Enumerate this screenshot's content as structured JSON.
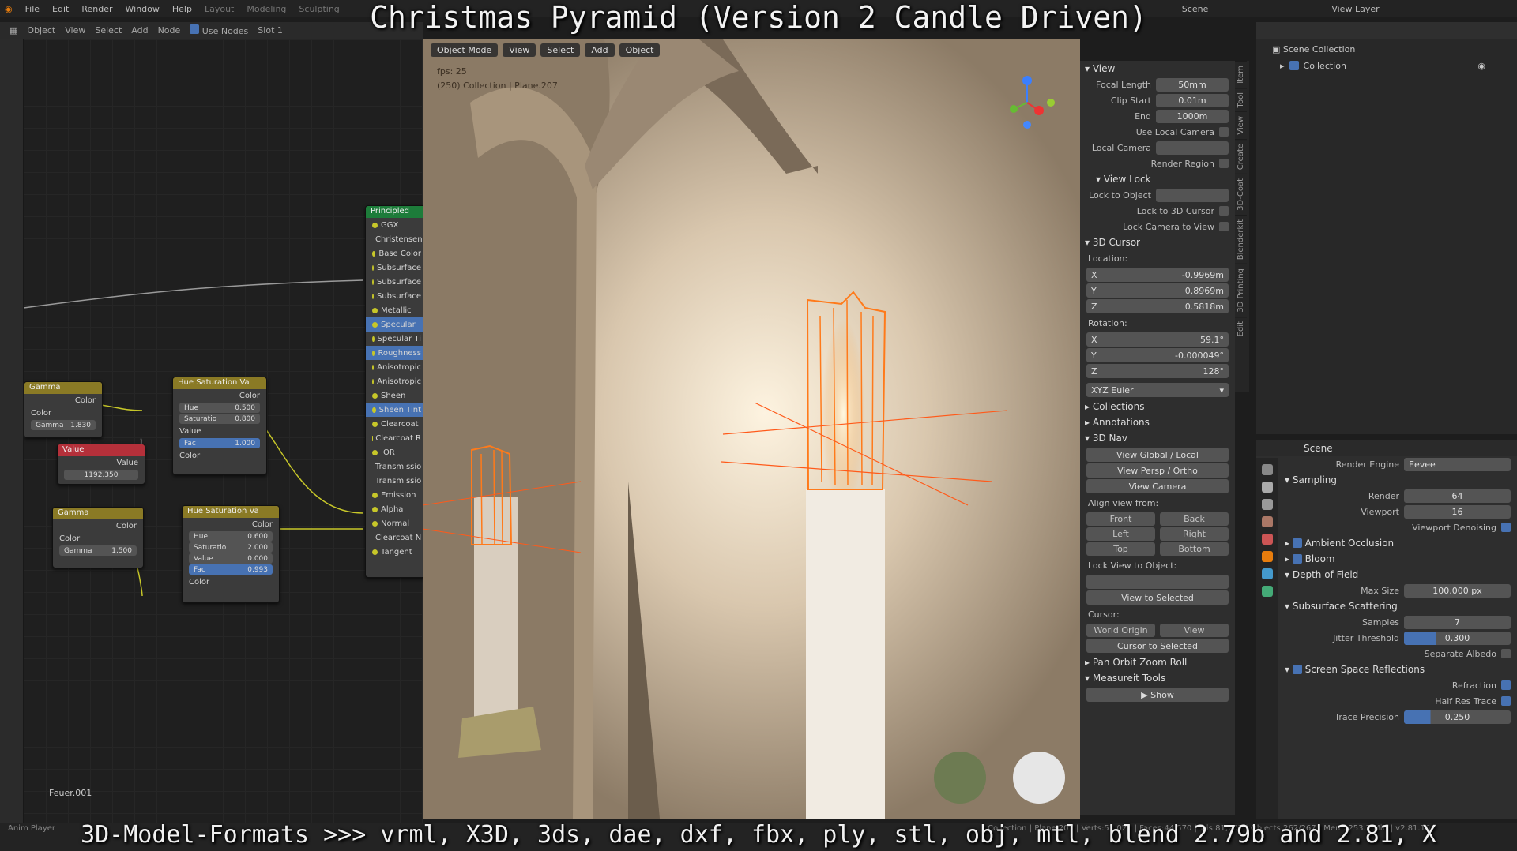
{
  "overlay": {
    "title": "Christmas Pyramid (Version 2 Candle Driven)",
    "bottom": "3D-Model-Formats >>> vrml, X3D, 3ds, dae, dxf, fbx, ply, stl, obj, mtl, blend 2.79b and 2.81, X"
  },
  "menubar": {
    "file": "File",
    "edit": "Edit",
    "render": "Render",
    "window": "Window",
    "help": "Help",
    "ws1": "Layout",
    "ws2": "Modeling",
    "ws3": "Sculpting",
    "scene": "Scene",
    "viewlayer": "View Layer"
  },
  "nodeheader": {
    "object": "Object",
    "view": "View",
    "select": "Select",
    "add": "Add",
    "node": "Node",
    "usenodes": "Use Nodes",
    "slot": "Slot 1"
  },
  "nodes": {
    "principled": {
      "title": "Principled",
      "inputs": [
        "GGX",
        "Christensen",
        "Base Color",
        "Subsurface",
        "Subsurface",
        "Subsurface",
        "Metallic",
        "Specular",
        "Specular Ti",
        "Roughness",
        "Anisotropic",
        "Anisotropic",
        "Sheen",
        "Sheen Tint",
        "Clearcoat",
        "Clearcoat R",
        "IOR",
        "Transmissio",
        "Transmissio",
        "Emission",
        "Alpha",
        "Normal",
        "Clearcoat N",
        "Tangent"
      ]
    },
    "gamma1": {
      "title": "Gamma",
      "out": "Color",
      "in": "Color",
      "gamma_label": "Gamma",
      "gamma": "1.830"
    },
    "value": {
      "title": "Value",
      "out": "Value",
      "val": "1192.350"
    },
    "gamma2": {
      "title": "Gamma",
      "out": "Color",
      "in": "Color",
      "gamma_label": "Gamma",
      "gamma": "1.500"
    },
    "hue1": {
      "title": "Hue Saturation Va",
      "out": "Color",
      "hue_l": "Hue",
      "hue": "0.500",
      "sat_l": "Saturatio",
      "sat": "0.800",
      "val_l": "Value",
      "fac_l": "Fac",
      "fac": "1.000",
      "color": "Color"
    },
    "hue2": {
      "title": "Hue Saturation Va",
      "out": "Color",
      "hue_l": "Hue",
      "hue": "0.600",
      "sat_l": "Saturatio",
      "sat": "2.000",
      "val_l": "Value",
      "val": "0.000",
      "fac_l": "Fac",
      "fac": "0.993",
      "color": "Color"
    },
    "material": "Feuer.001"
  },
  "viewport": {
    "mode": "Object Mode",
    "view": "View",
    "select": "Select",
    "add": "Add",
    "object": "Object",
    "fps": "fps: 25",
    "info": "(250) Collection | Plane.207"
  },
  "npanel": {
    "view": {
      "header": "View",
      "focal_l": "Focal Length",
      "focal": "50mm",
      "clipstart_l": "Clip Start",
      "clipstart": "0.01m",
      "end_l": "End",
      "end": "1000m",
      "uselocal": "Use Local Camera",
      "localcam": "Local Camera",
      "renderregion": "Render Region"
    },
    "viewlock": {
      "header": "View Lock",
      "lockobj": "Lock to Object",
      "lockcursor": "Lock to 3D Cursor",
      "lockcam": "Lock Camera to View"
    },
    "cursor": {
      "header": "3D Cursor",
      "location": "Location:",
      "x": "-0.9969m",
      "y": "0.8969m",
      "z": "0.5818m",
      "rotation": "Rotation:",
      "rx": "59.1°",
      "ry": "-0.000049°",
      "rz": "128°",
      "mode": "XYZ Euler",
      "xl": "X",
      "yl": "Y",
      "zl": "Z"
    },
    "collections": "Collections",
    "annotations": "Annotations",
    "nav": {
      "header": "3D Nav",
      "global": "View Global / Local",
      "persp": "View Persp / Ortho",
      "camera": "View Camera",
      "align": "Align view from:",
      "front": "Front",
      "back": "Back",
      "left": "Left",
      "right": "Right",
      "top": "Top",
      "bottom": "Bottom",
      "lockview": "Lock View to Object:",
      "selected": "View to Selected",
      "cursor": "Cursor:",
      "origin": "World Origin",
      "view": "View",
      "tosel": "Cursor to Selected"
    },
    "pan": "Pan Orbit Zoom Roll",
    "measure": "Measureit Tools",
    "show": "Show",
    "tabs": [
      "Item",
      "Tool",
      "View",
      "Create",
      "3D-Coat",
      "Blenderkit",
      "3D Printing",
      "Edit"
    ]
  },
  "outliner": {
    "title": "Scene Collection",
    "collection": "Collection"
  },
  "props": {
    "scene": "Scene",
    "engine_l": "Render Engine",
    "engine": "Eevee",
    "sampling": "Sampling",
    "render_l": "Render",
    "render": "64",
    "viewport_l": "Viewport",
    "viewport": "16",
    "denoise": "Viewport Denoising",
    "ao": "Ambient Occlusion",
    "bloom": "Bloom",
    "dof": "Depth of Field",
    "maxsize_l": "Max Size",
    "maxsize": "100.000 px",
    "sss": "Subsurface Scattering",
    "samples_l": "Samples",
    "samples": "7",
    "jitter_l": "Jitter Threshold",
    "jitter": "0.300",
    "sepalbedo": "Separate Albedo",
    "ssr": "Screen Space Reflections",
    "refraction": "Refraction",
    "halfres": "Half Res Trace",
    "trace_l": "Trace Precision",
    "trace": "0.250"
  },
  "status": {
    "left": "Anim Player",
    "right": "Collection | Plane.207 | Verts:51,021 | Faces:44,570 | Tris:81,207 | Objects:262/267 | Mem: 253.7 MiB | v2.81.16"
  },
  "colors": {
    "accent": "#4772b3",
    "selection": "#ff7a1a",
    "principled": "#1d7c3a",
    "gamma": "#8a7a25",
    "value": "#b5303a"
  }
}
